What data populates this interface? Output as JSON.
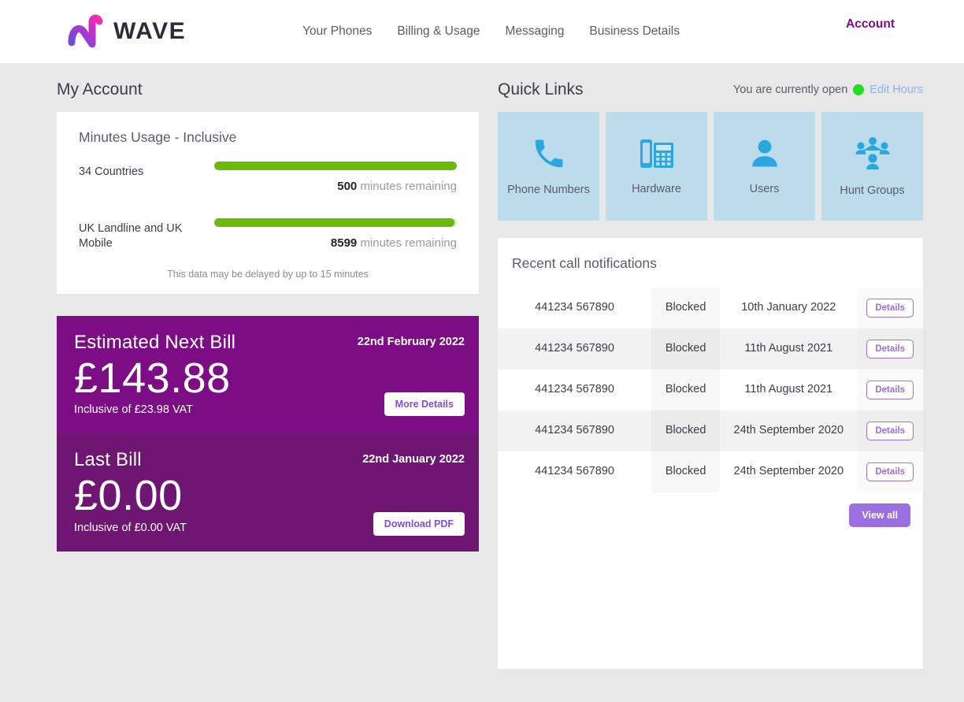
{
  "brand": {
    "name": "WAVE",
    "logo_gradient_from": "#7b4fd6",
    "logo_gradient_to": "#ef2fb0"
  },
  "nav": {
    "items": [
      {
        "label": "Your Phones"
      },
      {
        "label": "Billing & Usage"
      },
      {
        "label": "Messaging"
      },
      {
        "label": "Business Details"
      }
    ],
    "account_label": "Account",
    "account_color": "#7d0d85"
  },
  "left": {
    "section_title": "My Account",
    "usage": {
      "title": "Minutes Usage - Inclusive",
      "bar_color": "#6aba0a",
      "rows": [
        {
          "label": "34 Countries",
          "value": "500",
          "unit": "minutes remaining",
          "percent": 100
        },
        {
          "label": "UK Landline and UK Mobile",
          "value": "8599",
          "unit": "minutes remaining",
          "percent": 99
        }
      ],
      "note": "This data may be delayed by up to 15 minutes"
    },
    "next_bill": {
      "title": "Estimated Next Bill",
      "date": "22nd February 2022",
      "amount": "£143.88",
      "vat": "Inclusive of £23.98 VAT",
      "button": "More Details",
      "bg_color": "#7d0d85"
    },
    "last_bill": {
      "title": "Last Bill",
      "date": "22nd January 2022",
      "amount": "£0.00",
      "vat": "Inclusive of £0.00 VAT",
      "button": "Download PDF",
      "bg_color": "#6e1671"
    }
  },
  "right": {
    "section_title": "Quick Links",
    "status": {
      "text": "You are currently open",
      "dot_color": "#22dd22",
      "edit_link": "Edit Hours"
    },
    "tiles": [
      {
        "label": "Phone Numbers",
        "icon": "phone-icon"
      },
      {
        "label": "Hardware",
        "icon": "desk-phone-icon"
      },
      {
        "label": "Users",
        "icon": "user-icon"
      },
      {
        "label": "Hunt Groups",
        "icon": "group-icon"
      }
    ],
    "notifications": {
      "title": "Recent call notifications",
      "view_all_label": "View all",
      "details_label": "Details",
      "rows": [
        {
          "number": "441234 567890",
          "type": "Blocked",
          "date": "10th January 2022"
        },
        {
          "number": "441234 567890",
          "type": "Blocked",
          "date": "11th August 2021"
        },
        {
          "number": "441234 567890",
          "type": "Blocked",
          "date": "11th August 2021"
        },
        {
          "number": "441234 567890",
          "type": "Blocked",
          "date": "24th September 2020"
        },
        {
          "number": "441234 567890",
          "type": "Blocked",
          "date": "24th September 2020"
        }
      ]
    }
  }
}
